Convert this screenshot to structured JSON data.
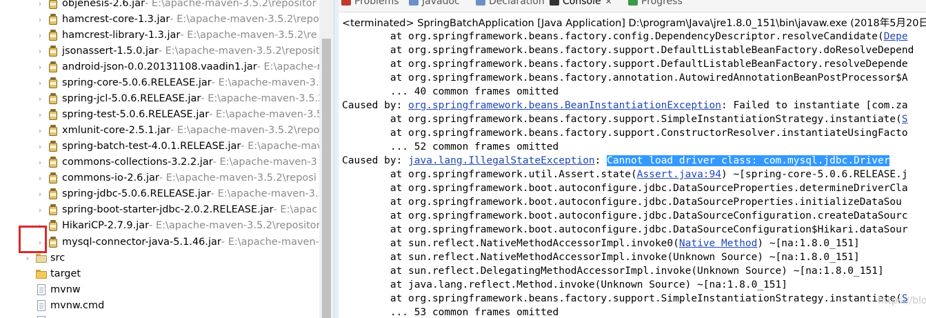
{
  "tree": {
    "jars": [
      {
        "name": "objenesis-2.6.jar",
        "path": " - E:\\apache-maven-3.5.2\\repositor"
      },
      {
        "name": "hamcrest-core-1.3.jar",
        "path": " - E:\\apache-maven-3.5.2\\repo"
      },
      {
        "name": "hamcrest-library-1.3.jar",
        "path": " - E:\\apache-maven-3.5.2\\re"
      },
      {
        "name": "jsonassert-1.5.0.jar",
        "path": " - E:\\apache-maven-3.5.2\\repositor"
      },
      {
        "name": "android-json-0.0.20131108.vaadin1.jar",
        "path": " - E:\\apache-r"
      },
      {
        "name": "spring-core-5.0.6.RELEASE.jar",
        "path": " - E:\\apache-maven-3.5."
      },
      {
        "name": "spring-jcl-5.0.6.RELEASE.jar",
        "path": " - E:\\apache-maven-3.5.2"
      },
      {
        "name": "spring-test-5.0.6.RELEASE.jar",
        "path": " - E:\\apache-maven-3.5"
      },
      {
        "name": "xmlunit-core-2.5.1.jar",
        "path": " - E:\\apache-maven-3.5.2\\repo"
      },
      {
        "name": "spring-batch-test-4.0.1.RELEASE.jar",
        "path": " - E:\\apache-mav"
      },
      {
        "name": "commons-collections-3.2.2.jar",
        "path": " - E:\\apache-maven-3"
      },
      {
        "name": "commons-io-2.6.jar",
        "path": " - E:\\apache-maven-3.5.2\\reposi"
      },
      {
        "name": "spring-jdbc-5.0.6.RELEASE.jar",
        "path": " - E:\\apache-maven-3.5"
      },
      {
        "name": "spring-boot-starter-jdbc-2.0.2.RELEASE.jar",
        "path": " - E:\\apac"
      },
      {
        "name": "HikariCP-2.7.9.jar",
        "path": " - E:\\apache-maven-3.5.2\\repositor"
      },
      {
        "name": "mysql-connector-java-5.1.46.jar",
        "path": " - E:\\apache-maven-"
      }
    ],
    "folders": [
      {
        "name": "src"
      },
      {
        "name": "target"
      }
    ],
    "files": [
      {
        "name": "mvnw"
      },
      {
        "name": "mvnw.cmd"
      }
    ]
  },
  "tabs": [
    {
      "label": "Problems",
      "color": "#c0392b"
    },
    {
      "label": "Javadoc",
      "color": "#6b8fc7"
    },
    {
      "label": "Declaration",
      "color": "#6b8fc7"
    },
    {
      "label": "Console",
      "color": "#333333",
      "close": "✕"
    },
    {
      "label": "Progress",
      "color": "#3a9a4a"
    }
  ],
  "console": {
    "title": "<terminated> SpringBatchApplication [Java Application] D:\\program\\Java\\jre1.8.0_151\\bin\\javaw.exe (2018年5月20日",
    "lines": [
      {
        "pre": "        at org.springframework.beans.factory.config.DependencyDescriptor.resolveCandidate(",
        "link": "Depe",
        "post": ""
      },
      {
        "pre": "        at org.springframework.beans.factory.support.DefaultListableBeanFactory.doResolveDepend",
        "link": "",
        "post": ""
      },
      {
        "pre": "        at org.springframework.beans.factory.support.DefaultListableBeanFactory.resolveDepende",
        "link": "",
        "post": ""
      },
      {
        "pre": "        at org.springframework.beans.factory.annotation.AutowiredAnnotationBeanPostProcessor$A",
        "link": "",
        "post": ""
      },
      {
        "pre": "        ... 40 common frames omitted",
        "link": "",
        "post": ""
      },
      {
        "pre": "Caused by: ",
        "link": "org.springframework.beans.BeanInstantiationException",
        "post": ": Failed to instantiate [com.za"
      },
      {
        "pre": "        at org.springframework.beans.factory.support.SimpleInstantiationStrategy.instantiate(",
        "link": "S",
        "post": ""
      },
      {
        "pre": "        at org.springframework.beans.factory.support.ConstructorResolver.instantiateUsingFacto",
        "link": "",
        "post": ""
      },
      {
        "pre": "        ... 52 common frames omitted",
        "link": "",
        "post": ""
      },
      {
        "pre": "Caused by: ",
        "link": "java.lang.IllegalStateException",
        "post": ": ",
        "highlight": "Cannot load driver class: com.mysql.jdbc.Driver"
      },
      {
        "pre": "        at org.springframework.util.Assert.state(",
        "link": "Assert.java:94",
        "post": ") ~[spring-core-5.0.6.RELEASE.j"
      },
      {
        "pre": "        at org.springframework.boot.autoconfigure.jdbc.DataSourceProperties.determineDriverCla",
        "link": "",
        "post": ""
      },
      {
        "pre": "        at org.springframework.boot.autoconfigure.jdbc.DataSourceProperties.initializeDataSou",
        "link": "",
        "post": ""
      },
      {
        "pre": "        at org.springframework.boot.autoconfigure.jdbc.DataSourceConfiguration.createDataSourc",
        "link": "",
        "post": ""
      },
      {
        "pre": "        at org.springframework.boot.autoconfigure.jdbc.DataSourceConfiguration$Hikari.dataSour",
        "link": "",
        "post": ""
      },
      {
        "pre": "        at sun.reflect.NativeMethodAccessorImpl.invoke0(",
        "link": "Native Method",
        "post": ") ~[na:1.8.0_151]"
      },
      {
        "pre": "        at sun.reflect.NativeMethodAccessorImpl.invoke(Unknown Source) ~[na:1.8.0_151]",
        "link": "",
        "post": ""
      },
      {
        "pre": "        at sun.reflect.DelegatingMethodAccessorImpl.invoke(Unknown Source) ~[na:1.8.0_151]",
        "link": "",
        "post": ""
      },
      {
        "pre": "        at java.lang.reflect.Method.invoke(Unknown Source) ~[na:1.8.0_151]",
        "link": "",
        "post": ""
      },
      {
        "pre": "        at org.springframework.beans.factory.support.SimpleInstantiationStrategy.instantiate(",
        "link": "S",
        "post": ""
      },
      {
        "pre": "        ... 53 common frames omitted",
        "link": "",
        "post": ""
      }
    ],
    "watermark": "https://blog.csdn.net/little_strong"
  }
}
